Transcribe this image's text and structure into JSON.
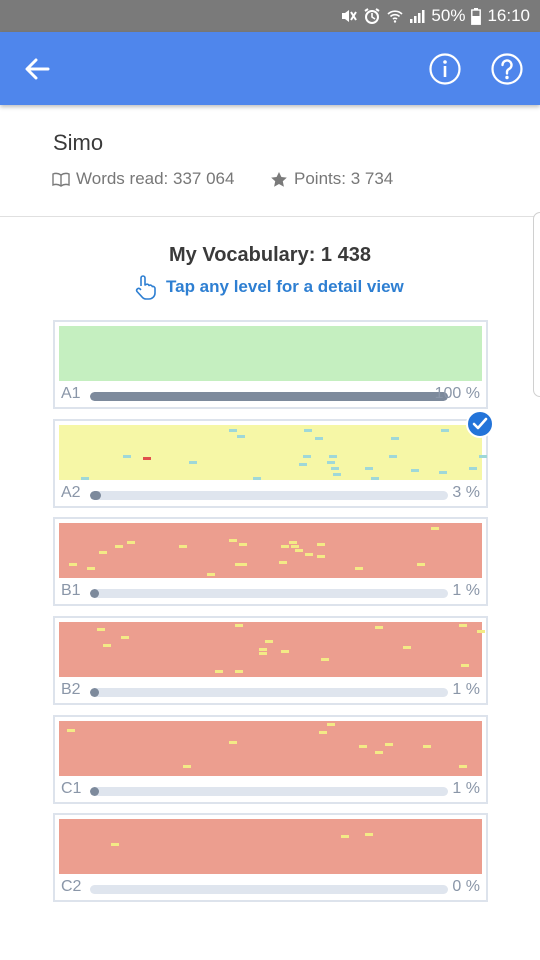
{
  "status_bar": {
    "battery_text": "50%",
    "time": "16:10",
    "icons": [
      "mute-vibrate-icon",
      "alarm-icon",
      "wifi-icon",
      "signal-icon",
      "battery-icon"
    ]
  },
  "app_bar": {
    "color": "#4f86ec",
    "icons": [
      "back-arrow-icon",
      "info-icon",
      "help-icon"
    ]
  },
  "profile": {
    "name": "Simo",
    "words_read": "Words read: 337 064",
    "points": "Points: 3 734",
    "icons": [
      "book-icon",
      "star-icon"
    ]
  },
  "vocabulary": {
    "title": "My Vocabulary: 1 438",
    "hint": "Tap any level for a detail view",
    "hint_icon": "tap-hand-icon"
  },
  "levels": [
    {
      "label": "A1",
      "percent": "100 %",
      "progress": 1.0,
      "color": "#c5efc0",
      "selected": false
    },
    {
      "label": "A2",
      "percent": "3 %",
      "progress": 0.03,
      "color": "#f6f7a6",
      "selected": true
    },
    {
      "label": "B1",
      "percent": "1 %",
      "progress": 0.01,
      "color": "#ec9e8f",
      "selected": false
    },
    {
      "label": "B2",
      "percent": "1 %",
      "progress": 0.01,
      "color": "#ec9e8f",
      "selected": false
    },
    {
      "label": "C1",
      "percent": "1 %",
      "progress": 0.01,
      "color": "#ec9e8f",
      "selected": false
    },
    {
      "label": "C2",
      "percent": "0 %",
      "progress": 0.0,
      "color": "#ec9e8f",
      "selected": false
    }
  ]
}
